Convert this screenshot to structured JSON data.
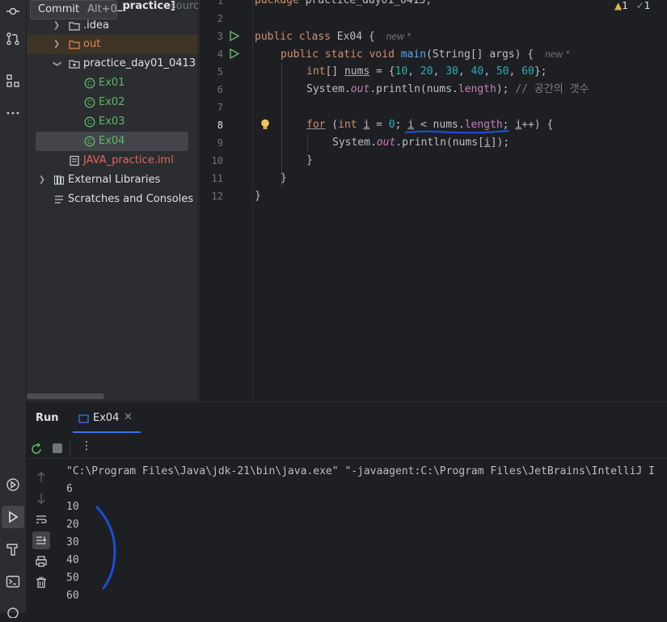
{
  "tooltip": {
    "label": "Commit",
    "shortcut": "Alt+0"
  },
  "project": {
    "title_fragment": "_practice]",
    "source_fragment": "sourc",
    "tree": [
      {
        "label": ".idea",
        "color": "default"
      },
      {
        "label": "out",
        "color": "orange"
      },
      {
        "label": "practice_day01_0413",
        "color": "default"
      },
      {
        "label": "Ex01",
        "color": "green"
      },
      {
        "label": "Ex02",
        "color": "green"
      },
      {
        "label": "Ex03",
        "color": "green"
      },
      {
        "label": "Ex04",
        "color": "green"
      },
      {
        "label": "JAVA_practice.iml",
        "color": "red"
      },
      {
        "label": "External Libraries",
        "color": "default"
      },
      {
        "label": "Scratches and Consoles",
        "color": "default"
      }
    ]
  },
  "editor": {
    "warnings": "1",
    "weak_warnings": "1",
    "line_numbers": [
      "1",
      "2",
      "3",
      "4",
      "5",
      "6",
      "7",
      "8",
      "9",
      "10",
      "11",
      "12"
    ],
    "current_line": "8",
    "hint_new": "new *",
    "line1": {
      "kw": "package",
      "rest": " practice_day01_0413;"
    },
    "line3": {
      "kw1": "public",
      "kw2": "class",
      "name": " Ex04 {"
    },
    "line4": {
      "kw1": "public",
      "kw2": "static",
      "kw3": "void",
      "fn": "main",
      "rest": "(String[] args) {"
    },
    "line5": {
      "kw": "int",
      "a": "[] ",
      "var": "nums",
      "b": " = {",
      "n1": "10",
      "n2": "20",
      "n3": "30",
      "n4": "40",
      "n5": "50",
      "n6": "60",
      "c": "};"
    },
    "line6": {
      "a": "System.",
      "out": "out",
      "b": ".println(nums.",
      "len": "length",
      "c": "); ",
      "comment": "// 공간의 갯수"
    },
    "line8": {
      "kw": "for",
      "a": " (",
      "kw2": "int",
      "i1": "i",
      "b": " = ",
      "zero": "0",
      "c": "; ",
      "i2": "i",
      "d": " < nums.",
      "len": "length",
      "e": "; ",
      "i3": "i",
      "f": "++) {"
    },
    "line9": {
      "a": "System.",
      "out": "out",
      "b": ".println(nums[",
      "i": "i",
      "c": "]);"
    },
    "line10": "}",
    "line11": "}",
    "line12": "}"
  },
  "run": {
    "title": "Run",
    "tab_label": "Ex04",
    "command": "\"C:\\Program Files\\Java\\jdk-21\\bin\\java.exe\" \"-javaagent:C:\\Program Files\\JetBrains\\IntelliJ I",
    "output": [
      "6",
      "10",
      "20",
      "30",
      "40",
      "50",
      "60"
    ]
  }
}
